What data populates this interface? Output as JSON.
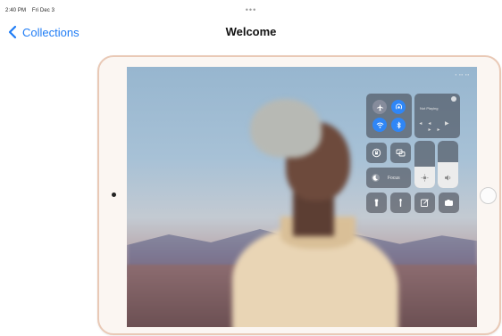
{
  "status_bar": {
    "time": "2:40 PM",
    "date": "Fri Dec 3"
  },
  "nav": {
    "back_label": "Collections",
    "title": "Welcome",
    "more_dots": "•••"
  },
  "colors": {
    "accent": "#1f7cf5",
    "device_frame": "#e9c9b6",
    "cc_active": "#2f86f6"
  },
  "device": {
    "screen_status": "▪ ▪▪ ▪▪",
    "control_center": {
      "connectivity": [
        {
          "name": "airplane",
          "icon": "airplane-icon",
          "active": false
        },
        {
          "name": "airdrop",
          "icon": "airdrop-icon",
          "active": true
        },
        {
          "name": "wifi",
          "icon": "wifi-icon",
          "active": true
        },
        {
          "name": "bluetooth",
          "icon": "bluetooth-icon",
          "active": true
        }
      ],
      "now_playing": {
        "label": "Not Playing",
        "controls": "◂◂ ▶ ▸▸"
      },
      "rotation_lock_icon": "rotation-lock-icon",
      "screen_mirror_icon": "screen-mirror-icon",
      "focus": {
        "icon": "moon-icon",
        "label": "Focus"
      },
      "brightness": {
        "icon": "brightness-icon",
        "level": 0.45
      },
      "volume": {
        "icon": "volume-icon",
        "level": 0.55
      },
      "shortcuts": [
        "flashlight-icon",
        "timer-icon",
        "notes-icon",
        "camera-icon"
      ]
    }
  }
}
